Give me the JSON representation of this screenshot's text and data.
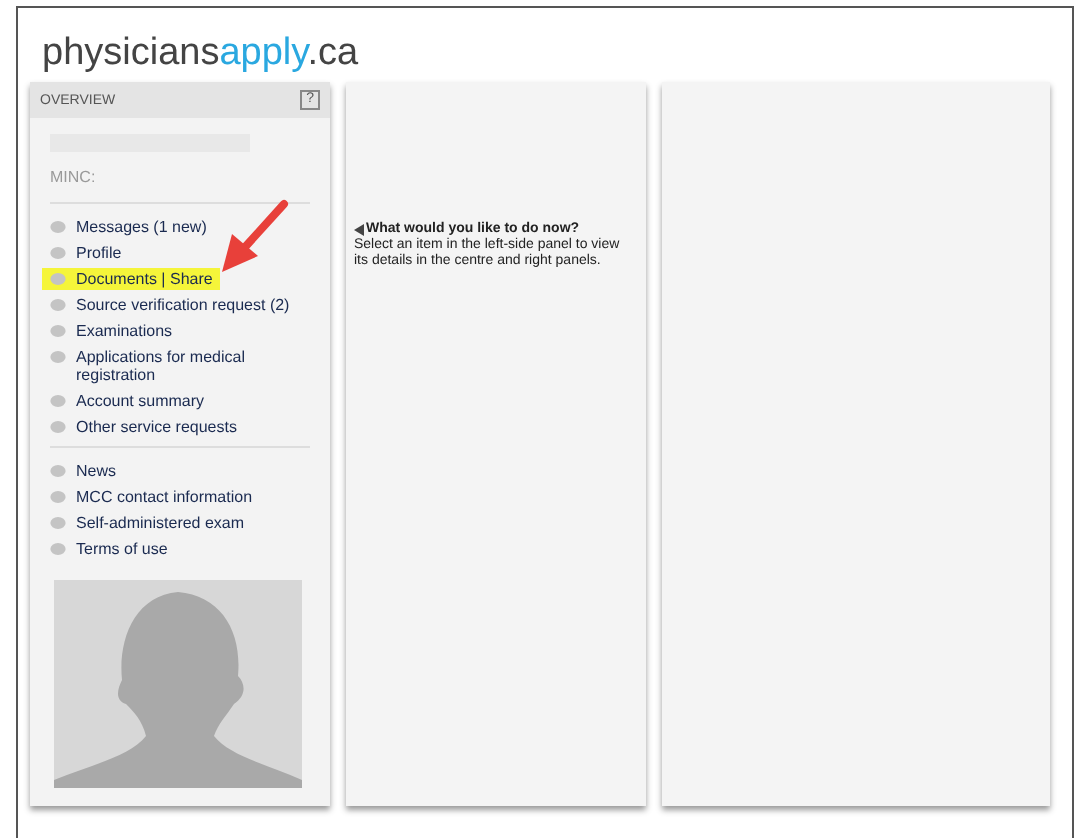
{
  "logo": {
    "part_1": "physicians",
    "part_2": "apply",
    "part_3": ".ca"
  },
  "sidebar": {
    "title": "OVERVIEW",
    "help": "?",
    "minc_label": "MINC:",
    "groups": [
      {
        "items": [
          {
            "label": "Messages (1 new)",
            "selected": false
          },
          {
            "label": "Profile",
            "selected": false
          },
          {
            "label": "Documents | Share",
            "selected": true
          },
          {
            "label": "Source verification request (2)",
            "selected": false
          },
          {
            "label": "Examinations",
            "selected": false
          },
          {
            "label": "Applications for medical registration",
            "selected": false
          },
          {
            "label": "Account summary",
            "selected": false
          },
          {
            "label": "Other service requests",
            "selected": false
          }
        ]
      },
      {
        "items": [
          {
            "label": "News",
            "selected": false
          },
          {
            "label": "MCC contact information",
            "selected": false
          },
          {
            "label": "Self-administered exam",
            "selected": false
          },
          {
            "label": "Terms of use",
            "selected": false
          }
        ]
      }
    ]
  },
  "center": {
    "heading": "What would you like to do now?",
    "text": "Select an item in the left-side panel to view its details in the centre and right panels."
  }
}
